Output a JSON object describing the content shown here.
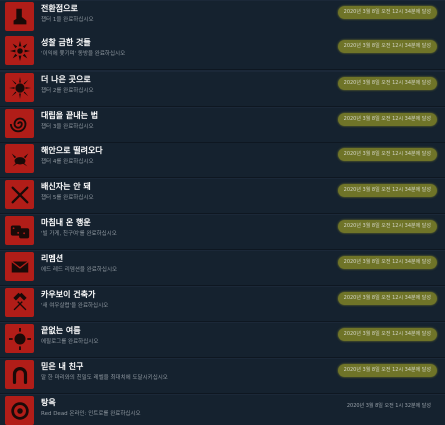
{
  "achievements": [
    {
      "title": "전환점으로",
      "desc": "챕터 1을 완료하십시오",
      "date": "2020년 3월 8일 오전 12시 34분에 달성",
      "icon": "boot-icon",
      "highlighted": true
    },
    {
      "title": "성찰 금한 것들",
      "desc": "'이익에 쫓기며' 동방을 완료하십시오",
      "date": "2020년 3월 8일 오전 12시 34분에 달성",
      "icon": "flower-burst-icon",
      "highlighted": true
    },
    {
      "title": "더 나은 곳으로",
      "desc": "챕터 2를 완료하십시오",
      "date": "2020년 3월 8일 오전 12시 34분에 달성",
      "icon": "sun-burst-icon",
      "highlighted": true
    },
    {
      "title": "대립을 끝내는 법",
      "desc": "챕터 3을 완료하십시오",
      "date": "2020년 3월 8일 오전 12시 34분에 달성",
      "icon": "spiral-icon",
      "highlighted": true
    },
    {
      "title": "해안으로 떨려오다",
      "desc": "챕터 4를 완료하십시오",
      "date": "2020년 3월 8일 오전 12시 34분에 달성",
      "icon": "crab-icon",
      "highlighted": true
    },
    {
      "title": "배신자는 안 돼",
      "desc": "챕터 5를 완료하십시오",
      "date": "2020년 3월 8일 오전 12시 34분에 달성",
      "icon": "crossed-knives-icon",
      "highlighted": true
    },
    {
      "title": "마침내 온 행운",
      "desc": "'빌 가게, 친구여'를 완료하십시오",
      "date": "2020년 3월 8일 오전 12시 34분에 달성",
      "icon": "dice-icon",
      "highlighted": true
    },
    {
      "title": "리멤션",
      "desc": "에드 레드 리뎀션을 완료하십시오",
      "date": "2020년 3월 8일 오전 12시 34분에 달성",
      "icon": "envelope-icon",
      "highlighted": true
    },
    {
      "title": "카우보이 건축가",
      "desc": "'새 여우살렵'을 완료하십시오",
      "date": "2020년 3월 8일 오전 12시 34분에 달성",
      "icon": "crossed-hammers-icon",
      "highlighted": true
    },
    {
      "title": "끝없는 여름",
      "desc": "에필로그를 완료하십시오",
      "date": "2020년 3월 8일 오전 12시 34분에 달성",
      "icon": "sun-icon",
      "highlighted": true
    },
    {
      "title": "믿은 내 친구",
      "desc": "말 한 마리와의 친밀도 레벨을 최대치에 도달시키십시오",
      "date": "2020년 3월 8일 오전 12시 34분에 달성",
      "icon": "horseshoe-icon",
      "highlighted": true
    },
    {
      "title": "탕옥",
      "desc": "Red Dead 온라인: 인트로를 완료하십시오",
      "date": "2020년 3월 8일 오전 1시 32분에 달성",
      "icon": "wreath-icon",
      "highlighted": false
    }
  ],
  "colors": {
    "background": "#1b2838",
    "row": "#15222f",
    "icon_bg": "#b11d18",
    "icon_fg": "#1a0a08",
    "highlight": "#bab822"
  }
}
